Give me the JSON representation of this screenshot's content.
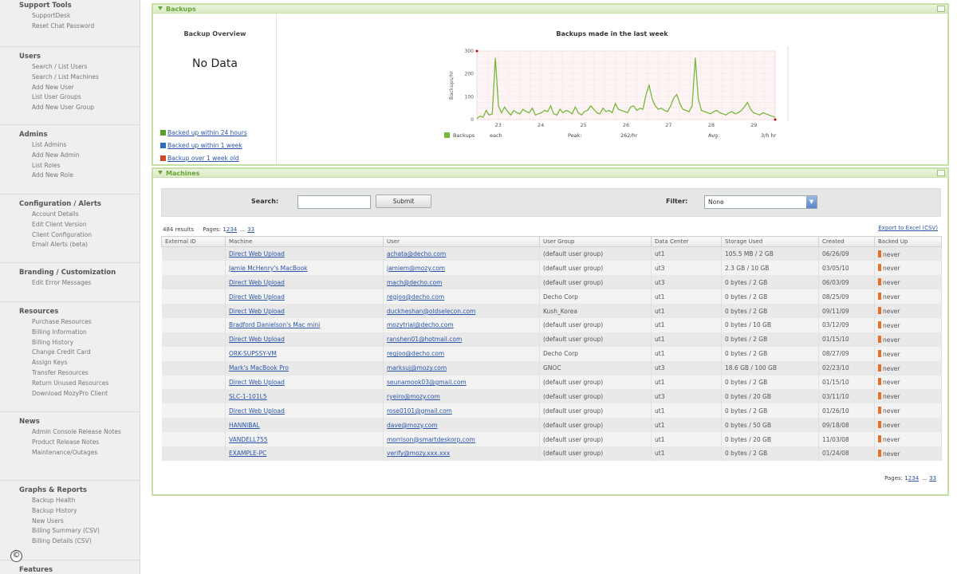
{
  "sidebar": {
    "sections": [
      {
        "title": "Support Tools",
        "items": [
          "SupportDesk",
          "Reset Chat Password"
        ]
      },
      {
        "title": "Users",
        "items": [
          "Search / List Users",
          "Search / List Machines",
          "Add New User",
          "List User Groups",
          "Add New User Group"
        ]
      },
      {
        "title": "Admins",
        "items": [
          "List Admins",
          "Add New Admin",
          "List Roles",
          "Add New Role"
        ]
      },
      {
        "title": "Configuration / Alerts",
        "items": [
          "Account Details",
          "Edit Client Version",
          "Client Configuration",
          "Email Alerts (beta)"
        ]
      },
      {
        "title": "Branding / Customization",
        "items": [
          "Edit Error Messages"
        ]
      },
      {
        "title": "Resources",
        "items": [
          "Purchase Resources",
          "Billing Information",
          "Billing History",
          "Change Credit Card",
          "Assign Keys",
          "Transfer Resources",
          "Return Unused Resources",
          "Download MozyPro Client"
        ]
      },
      {
        "title": "News",
        "items": [
          "Admin Console Release Notes",
          "Product Release Notes",
          "Maintenance/Outages"
        ]
      },
      {
        "title": "Graphs & Reports",
        "items": [
          "Backup Health",
          "Backup History",
          "New Users",
          "Billing Summary (CSV)",
          "Billing Details (CSV)"
        ]
      },
      {
        "title": "Features",
        "items": []
      }
    ],
    "copyright_symbol": "©"
  },
  "backups_panel": {
    "title": "Backups",
    "overview_title": "Backup Overview",
    "no_data": "No Data",
    "legend_links": [
      {
        "label": "Backed up within 24 hours",
        "color": "#5a9e2c"
      },
      {
        "label": "Backed up within 1 week",
        "color": "#2f6db8"
      },
      {
        "label": "Backup over 1 week old",
        "color": "#d04a2a"
      }
    ],
    "chart_title": "Backups made in the last week"
  },
  "chart_data": {
    "type": "line",
    "title": "Backups made in the last week",
    "ylabel": "Backups/hr",
    "ylim": [
      0,
      300
    ],
    "yticks": [
      "0",
      "100",
      "200",
      "300"
    ],
    "xticks": [
      "23",
      "24",
      "25",
      "26",
      "27",
      "28",
      "29"
    ],
    "series": [
      {
        "name": "Backups",
        "color": "#77b83a",
        "values": [
          5,
          15,
          10,
          40,
          20,
          25,
          270,
          60,
          30,
          55,
          35,
          20,
          40,
          30,
          25,
          45,
          35,
          30,
          50,
          20,
          25,
          30,
          40,
          35,
          60,
          25,
          20,
          45,
          30,
          40,
          35,
          25,
          55,
          30,
          20,
          35,
          40,
          60,
          45,
          30,
          25,
          50,
          35,
          40,
          30,
          70,
          45,
          40,
          35,
          30,
          55,
          60,
          40,
          50,
          45,
          110,
          150,
          90,
          60,
          45,
          50,
          40,
          35,
          60,
          95,
          110,
          70,
          45,
          40,
          35,
          60,
          270,
          90,
          40,
          35,
          30,
          25,
          35,
          40,
          30,
          25,
          20,
          30,
          35,
          25,
          30,
          40,
          55,
          75,
          45,
          30,
          25,
          20,
          30,
          25,
          20,
          15,
          10
        ]
      }
    ],
    "legend": {
      "series_label": "Backups",
      "unit": "each",
      "peak_label": "Peak:",
      "peak_value": "262/hr",
      "avg_label": "Avg:",
      "avg_value": "3/h hr"
    }
  },
  "machines_panel": {
    "title": "Machines",
    "search_label": "Search:",
    "search_value": "",
    "submit_label": "Submit",
    "filter_label": "Filter:",
    "filter_value": "None",
    "results_text": "484 results",
    "pages_label": "Pages:",
    "pages": [
      "1",
      "2",
      "3",
      "4",
      "...",
      "33"
    ],
    "export_label": "Export to Excel (CSV)",
    "columns": [
      "External ID",
      "Machine",
      "User",
      "User Group",
      "Data Center",
      "Storage Used",
      "Created",
      "Backed Up"
    ],
    "rows": [
      [
        "",
        "Direct Web Upload",
        "achata@decho.com",
        "(default user group)",
        "ut1",
        "105.5 MB / 2 GB",
        "06/26/09",
        "never"
      ],
      [
        "",
        "Jamie McHenry's MacBook",
        "jamiem@mozy.com",
        "(default user group)",
        "ut3",
        "2.3 GB / 10 GB",
        "03/05/10",
        "never"
      ],
      [
        "",
        "Direct Web Upload",
        "mach@decho.com",
        "(default user group)",
        "ut3",
        "0 bytes / 2 GB",
        "06/03/09",
        "never"
      ],
      [
        "",
        "Direct Web Upload",
        "regjoo@decho.com",
        "Decho Corp",
        "ut1",
        "0 bytes / 2 GB",
        "08/25/09",
        "never"
      ],
      [
        "",
        "Direct Web Upload",
        "duckheshan@oldselecon.com",
        "Kush_Korea",
        "ut1",
        "0 bytes / 2 GB",
        "09/11/09",
        "never"
      ],
      [
        "",
        "Bradford Danielson's Mac mini",
        "mozytrial@decho.com",
        "(default user group)",
        "ut1",
        "0 bytes / 10 GB",
        "03/12/09",
        "never"
      ],
      [
        "",
        "Direct Web Upload",
        "ranshen01@hotmail.com",
        "(default user group)",
        "ut1",
        "0 bytes / 2 GB",
        "01/15/10",
        "never"
      ],
      [
        "",
        "ORK-SUPSSY-VM",
        "regjoo@decho.com",
        "Decho Corp",
        "ut1",
        "0 bytes / 2 GB",
        "08/27/09",
        "never"
      ],
      [
        "",
        "Mark's MacBook Pro",
        "marksuj@mozy.com",
        "GNOC",
        "ut3",
        "18.6 GB / 100 GB",
        "02/23/10",
        "never"
      ],
      [
        "",
        "Direct Web Upload",
        "seunamook03@gmail.com",
        "(default user group)",
        "ut1",
        "0 bytes / 2 GB",
        "01/15/10",
        "never"
      ],
      [
        "",
        "SLC-1-101L5",
        "ryeiro@mozy.com",
        "(default user group)",
        "ut3",
        "0 bytes / 20 GB",
        "03/11/10",
        "never"
      ],
      [
        "",
        "Direct Web Upload",
        "rose0101@gmail.com",
        "(default user group)",
        "ut1",
        "0 bytes / 2 GB",
        "01/26/10",
        "never"
      ],
      [
        "",
        "HANNIBAL",
        "dave@mozy.com",
        "(default user group)",
        "ut1",
        "0 bytes / 50 GB",
        "09/18/08",
        "never"
      ],
      [
        "",
        "VANDELL755",
        "morrison@smartdeskorp.com",
        "(default user group)",
        "ut1",
        "0 bytes / 20 GB",
        "11/03/08",
        "never"
      ],
      [
        "",
        "EXAMPLE-PC",
        "verify@mozy.xxx.xxx",
        "(default user group)",
        "ut1",
        "0 bytes / 2 GB",
        "01/24/08",
        "never"
      ]
    ]
  }
}
